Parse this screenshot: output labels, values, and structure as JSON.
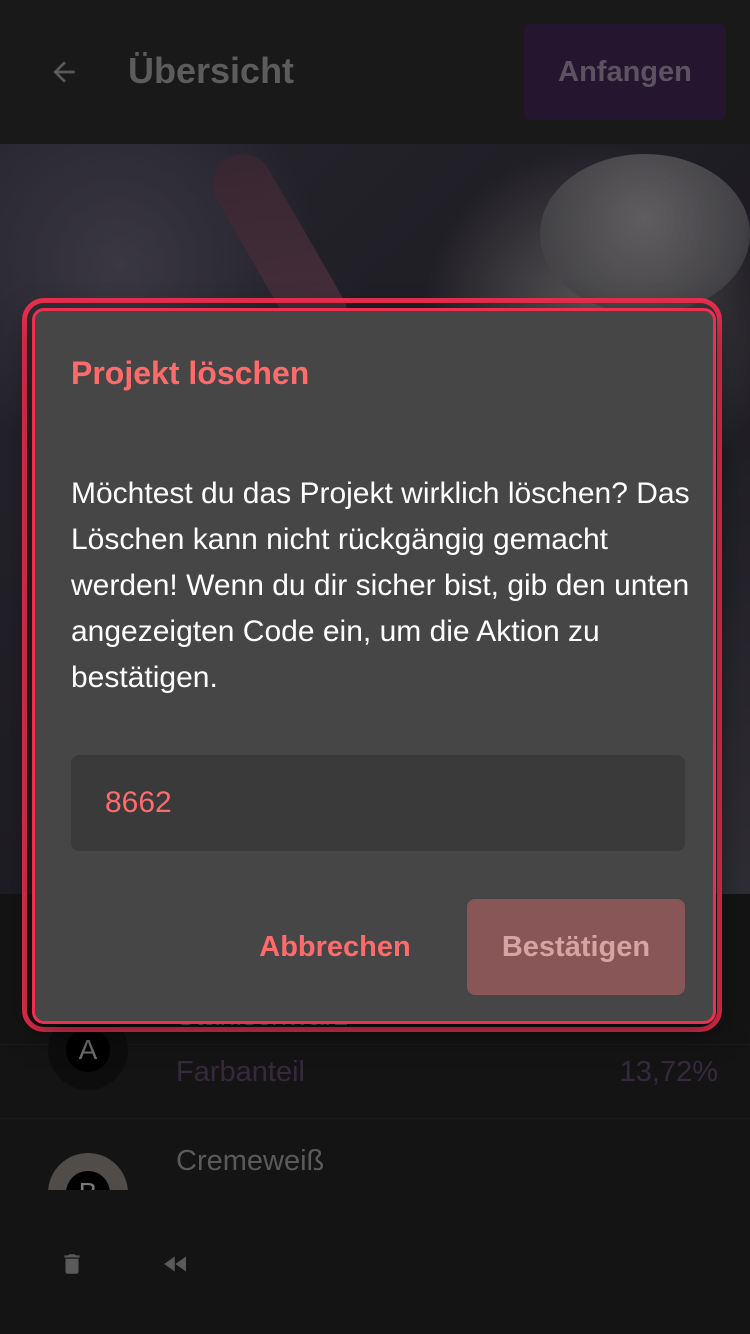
{
  "header": {
    "title": "Übersicht",
    "back_icon": "arrow-left-icon",
    "start_label": "Anfangen"
  },
  "list": {
    "items": [
      {
        "avatar_letter": "A",
        "name": "Stahlschwarz",
        "share_label": "Farbanteil",
        "share_value": "13,72%"
      },
      {
        "avatar_letter": "B",
        "name": "Cremeweiß"
      }
    ]
  },
  "bottombar": {
    "delete_icon": "trash-icon",
    "rewind_icon": "rewind-icon"
  },
  "dialog": {
    "title": "Projekt löschen",
    "message": "Möchtest du das Projekt wirklich löschen? Das Löschen kann nicht rückgängig gemacht werden! Wenn du dir sicher bist, gib den unten angezeigten Code ein, um die Aktion zu bestätigen.",
    "code_value": "8662",
    "cancel_label": "Abbrechen",
    "confirm_label": "Bestätigen"
  },
  "colors": {
    "accent": "#ff6a6a",
    "highlight": "#ee3050",
    "start_button": "#3a2148"
  }
}
